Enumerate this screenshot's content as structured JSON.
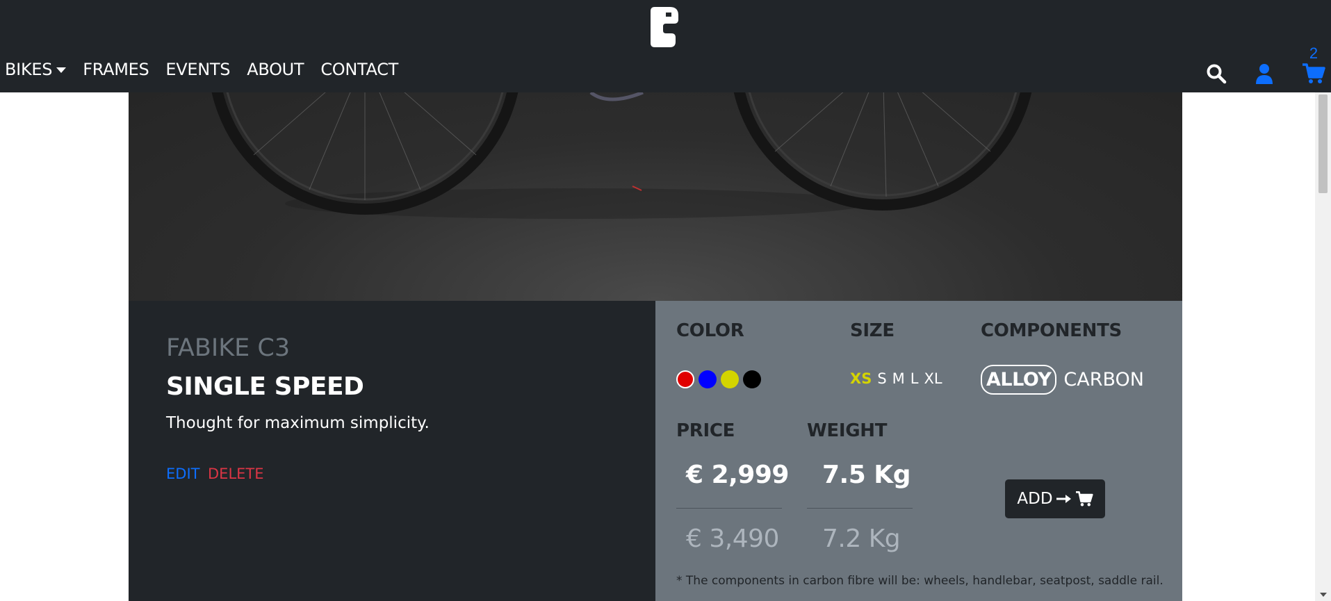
{
  "nav": {
    "logo_icon": "fabike-logo-icon",
    "items": [
      {
        "label": "BIKES",
        "has_dropdown": true
      },
      {
        "label": "FRAMES"
      },
      {
        "label": "EVENTS"
      },
      {
        "label": "ABOUT"
      },
      {
        "label": "CONTACT"
      }
    ],
    "icons": [
      "search-icon",
      "user-icon",
      "cart-icon"
    ],
    "cart_count": "2",
    "accent_color": "#0d6efd"
  },
  "product": {
    "brand": "FABIKE C3",
    "model": "SINGLE SPEED",
    "tagline": "Thought for maximum simplicity.",
    "edit_label": "EDIT",
    "delete_label": "DELETE"
  },
  "options": {
    "color_title": "COLOR",
    "colors": [
      {
        "name": "red",
        "hex": "#e00000",
        "selected": true
      },
      {
        "name": "blue",
        "hex": "#0000ff"
      },
      {
        "name": "yellow",
        "hex": "#d4d400"
      },
      {
        "name": "black",
        "hex": "#000000"
      }
    ],
    "size_title": "SIZE",
    "sizes": [
      "XS",
      "S",
      "M",
      "L",
      "XL"
    ],
    "selected_size": "XS",
    "components_title": "COMPONENTS",
    "components": [
      "ALLOY",
      "CARBON"
    ],
    "selected_component": "ALLOY",
    "price_title": "PRICE",
    "price_current": "€ 2,999",
    "price_alternative": "€ 3,490",
    "weight_title": "WEIGHT",
    "weight_current": "7.5 Kg",
    "weight_alternative": "7.2 Kg",
    "add_label": "ADD",
    "carbon_note": "* The components in carbon fibre will be: wheels, handlebar, seatpost, saddle rail."
  }
}
